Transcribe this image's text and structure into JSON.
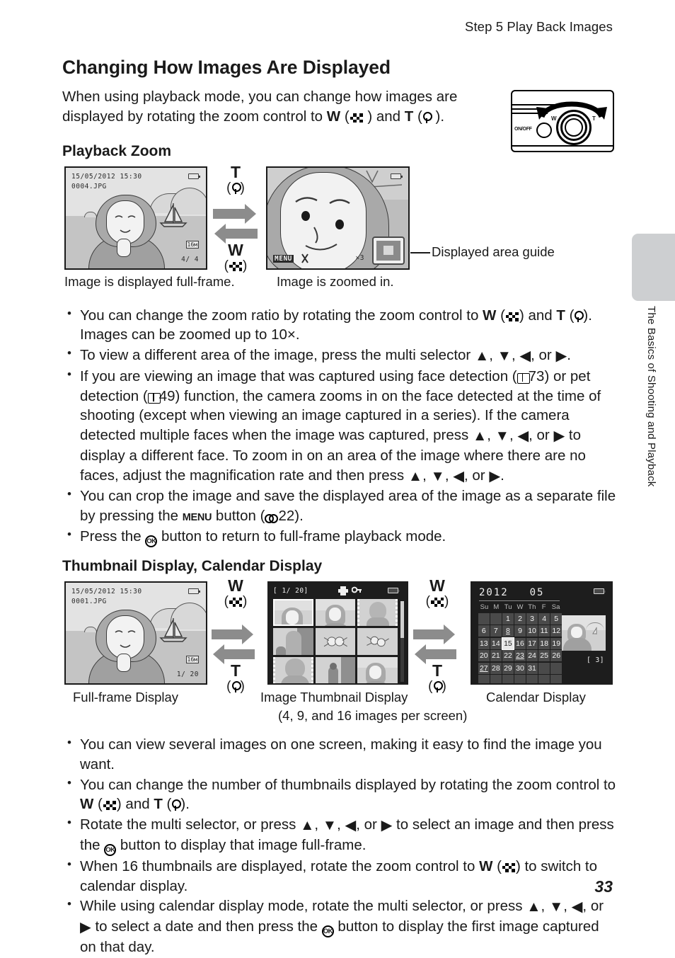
{
  "running_head": "Step 5 Play Back Images",
  "side_tab": {
    "label": "The Basics of Shooting and Playback"
  },
  "page_number": "33",
  "title": "Changing How Images Are Displayed",
  "intro": {
    "part1": "When using playback mode, you can change how images are displayed by rotating the zoom control to ",
    "w": "W",
    "mid": " ) and ",
    "t": "T",
    "end": " )."
  },
  "sections": [
    {
      "heading": "Playback Zoom",
      "screens": [
        {
          "name": "full-frame",
          "osd_date": "15/05/2012",
          "osd_time": "15:30",
          "osd_file": "0004.JPG",
          "osd_counter": "4/   4",
          "osd_imagesize": "16м"
        },
        {
          "name": "zoomed",
          "osd_menu": "MENU",
          "osd_zoom": "×3"
        }
      ],
      "zoom_labels": {
        "top_letter": "T",
        "top_icon": "magnifier",
        "bottom_letter": "W",
        "bottom_icon": "thumbnail-grid"
      },
      "callout": "Displayed area guide",
      "captions": [
        "Image is displayed full-frame.",
        "Image is zoomed in."
      ],
      "bullets": [
        {
          "segments": [
            {
              "t": "text",
              "v": "You can change the zoom ratio by rotating the zoom control to "
            },
            {
              "t": "w",
              "v": "W"
            },
            {
              "t": "text",
              "v": " ("
            },
            {
              "t": "chk",
              "v": ""
            },
            {
              "t": "text",
              "v": ") and "
            },
            {
              "t": "t",
              "v": "T"
            },
            {
              "t": "text",
              "v": " ("
            },
            {
              "t": "mag",
              "v": ""
            },
            {
              "t": "text",
              "v": "). Images can be zoomed up to 10×."
            }
          ]
        },
        {
          "segments": [
            {
              "t": "text",
              "v": "To view a different area of the image, press the multi selector "
            },
            {
              "t": "tri",
              "v": "▲"
            },
            {
              "t": "text",
              "v": ", "
            },
            {
              "t": "tri",
              "v": "▼"
            },
            {
              "t": "text",
              "v": ", "
            },
            {
              "t": "tri",
              "v": "◀"
            },
            {
              "t": "text",
              "v": ", or "
            },
            {
              "t": "tri",
              "v": "▶"
            },
            {
              "t": "text",
              "v": "."
            }
          ]
        },
        {
          "segments": [
            {
              "t": "text",
              "v": "If you are viewing an image that was captured using face detection ("
            },
            {
              "t": "book",
              "v": ""
            },
            {
              "t": "text",
              "v": "73) or pet detection ("
            },
            {
              "t": "book",
              "v": ""
            },
            {
              "t": "text",
              "v": "49) function, the camera zooms in on the face detected at the time of shooting (except when viewing an image captured in a series). If the camera detected multiple faces when the image was captured, press "
            },
            {
              "t": "tri",
              "v": "▲"
            },
            {
              "t": "text",
              "v": ", "
            },
            {
              "t": "tri",
              "v": "▼"
            },
            {
              "t": "text",
              "v": ", "
            },
            {
              "t": "tri",
              "v": "◀"
            },
            {
              "t": "text",
              "v": ", or "
            },
            {
              "t": "tri",
              "v": "▶"
            },
            {
              "t": "text",
              "v": " to display a different face. To zoom in on an area of the image where there are no faces, adjust the magnification rate and then press "
            },
            {
              "t": "tri",
              "v": "▲"
            },
            {
              "t": "text",
              "v": ", "
            },
            {
              "t": "tri",
              "v": "▼"
            },
            {
              "t": "text",
              "v": ", "
            },
            {
              "t": "tri",
              "v": "◀"
            },
            {
              "t": "text",
              "v": ", or "
            },
            {
              "t": "tri",
              "v": "▶"
            },
            {
              "t": "text",
              "v": "."
            }
          ]
        },
        {
          "segments": [
            {
              "t": "text",
              "v": "You can crop the image and save the displayed area of the image as a separate file by pressing the "
            },
            {
              "t": "menu",
              "v": "MENU"
            },
            {
              "t": "text",
              "v": " button ("
            },
            {
              "t": "ebook",
              "v": ""
            },
            {
              "t": "text",
              "v": "22)."
            }
          ]
        },
        {
          "segments": [
            {
              "t": "text",
              "v": "Press the "
            },
            {
              "t": "ok",
              "v": "OK"
            },
            {
              "t": "text",
              "v": " button to return to full-frame playback mode."
            }
          ]
        }
      ]
    },
    {
      "heading": "Thumbnail Display, Calendar Display",
      "screens": [
        {
          "name": "full-frame",
          "osd_date": "15/05/2012",
          "osd_time": "15:30",
          "osd_file": "0001.JPG",
          "osd_counter": "1/  20",
          "osd_imagesize": "16м"
        },
        {
          "name": "thumbnail-grid",
          "osd_counter": "[    1/   20]"
        },
        {
          "name": "calendar",
          "year": "2012",
          "month": "05",
          "weekday_headers": [
            "Su",
            "M",
            "Tu",
            "W",
            "Th",
            "F",
            "Sa"
          ],
          "weeks": [
            [
              "",
              "",
              "1",
              "2",
              "3",
              "4",
              "5"
            ],
            [
              "6",
              "7",
              "8",
              "9",
              "10",
              "11",
              "12"
            ],
            [
              "13",
              "14",
              "15",
              "16",
              "17",
              "18",
              "19"
            ],
            [
              "20",
              "21",
              "22",
              "23",
              "24",
              "25",
              "26"
            ],
            [
              "27",
              "28",
              "29",
              "30",
              "31",
              "",
              ""
            ],
            [
              "",
              "",
              "",
              "",
              "",
              "",
              ""
            ]
          ],
          "selected_day": "15",
          "underlined_days": [
            "8",
            "23",
            "27"
          ],
          "thumb_count": "[    3]"
        }
      ],
      "zoom_labels": {
        "top_letter": "W",
        "top_icon": "thumbnail-grid",
        "bottom_letter": "T",
        "bottom_icon": "magnifier"
      },
      "captions": [
        "Full-frame Display",
        "Image Thumbnail Display",
        "(4, 9, and 16 images per screen)",
        "Calendar Display"
      ],
      "bullets": [
        {
          "segments": [
            {
              "t": "text",
              "v": "You can view several images on one screen, making it easy to find the image you want."
            }
          ]
        },
        {
          "segments": [
            {
              "t": "text",
              "v": "You can change the number of thumbnails displayed by rotating the zoom control to "
            },
            {
              "t": "w",
              "v": "W"
            },
            {
              "t": "text",
              "v": " ("
            },
            {
              "t": "chk",
              "v": ""
            },
            {
              "t": "text",
              "v": ") and "
            },
            {
              "t": "t",
              "v": "T"
            },
            {
              "t": "text",
              "v": " ("
            },
            {
              "t": "mag",
              "v": ""
            },
            {
              "t": "text",
              "v": ")."
            }
          ]
        },
        {
          "segments": [
            {
              "t": "text",
              "v": "Rotate the multi selector, or press "
            },
            {
              "t": "tri",
              "v": "▲"
            },
            {
              "t": "text",
              "v": ", "
            },
            {
              "t": "tri",
              "v": "▼"
            },
            {
              "t": "text",
              "v": ", "
            },
            {
              "t": "tri",
              "v": "◀"
            },
            {
              "t": "text",
              "v": ", or "
            },
            {
              "t": "tri",
              "v": "▶"
            },
            {
              "t": "text",
              "v": " to select an image and then press the "
            },
            {
              "t": "ok",
              "v": "OK"
            },
            {
              "t": "text",
              "v": " button to display that image full-frame."
            }
          ]
        },
        {
          "segments": [
            {
              "t": "text",
              "v": "When 16 thumbnails are displayed, rotate the zoom control to "
            },
            {
              "t": "w",
              "v": "W"
            },
            {
              "t": "text",
              "v": " ("
            },
            {
              "t": "chk",
              "v": ""
            },
            {
              "t": "text",
              "v": ") to switch to calendar display."
            }
          ]
        },
        {
          "segments": [
            {
              "t": "text",
              "v": "While using calendar display mode, rotate the multi selector, or press "
            },
            {
              "t": "tri",
              "v": "▲"
            },
            {
              "t": "text",
              "v": ", "
            },
            {
              "t": "tri",
              "v": "▼"
            },
            {
              "t": "text",
              "v": ", "
            },
            {
              "t": "tri",
              "v": "◀"
            },
            {
              "t": "text",
              "v": ", or "
            },
            {
              "t": "tri",
              "v": "▶"
            },
            {
              "t": "text",
              "v": " to select a date and then press the "
            },
            {
              "t": "ok",
              "v": "OK"
            },
            {
              "t": "text",
              "v": " button to display the first image captured on that day."
            }
          ]
        }
      ]
    }
  ],
  "camera_illustration": {
    "onoff_label": "ON/OFF",
    "w_label": "W",
    "t_label": "T"
  },
  "colors": {
    "tab_gray": "#cdcfd1",
    "arrow_gray": "#8c8c8c",
    "lcd_dark": "#1d1d1d"
  }
}
